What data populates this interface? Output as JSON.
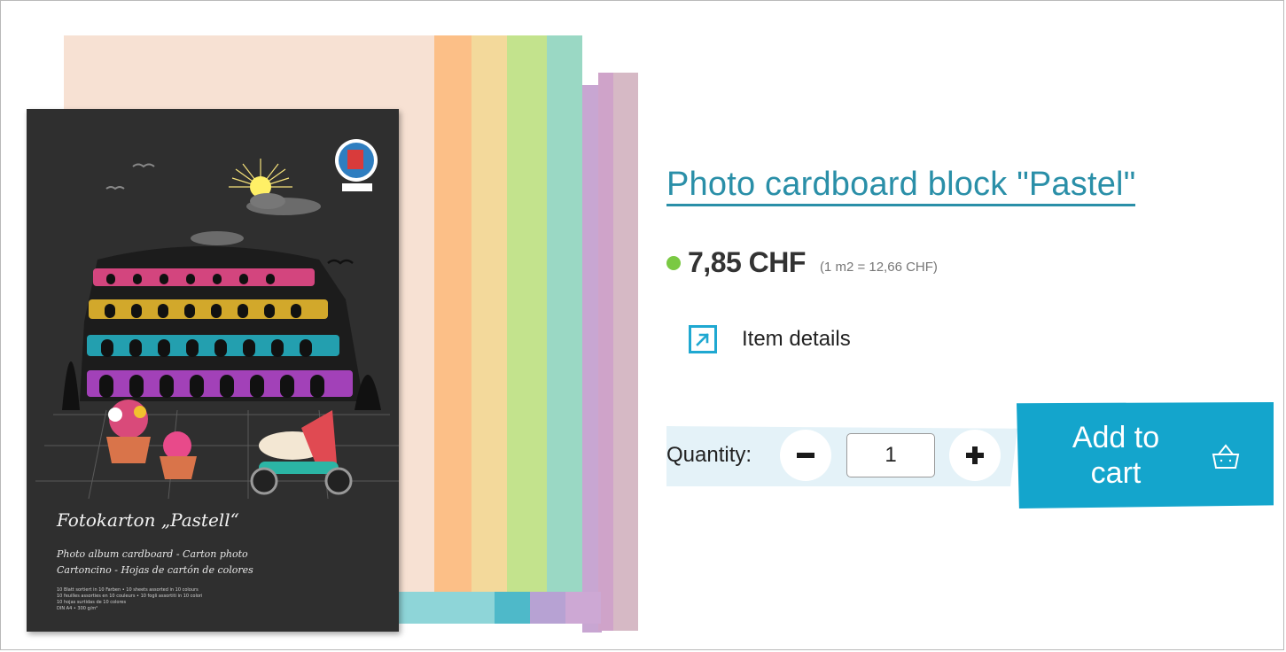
{
  "product": {
    "title": "Photo cardboard block \"Pastel\"",
    "price": "7,85 CHF",
    "unit_price": "(1 m2 = 12,66 CHF)",
    "availability_color": "#7ac943",
    "details_label": "Item details",
    "image": {
      "brand": "URSUS",
      "cover_title": "Fotokarton „Pastell“",
      "cover_subtitle": "Photo album cardboard - Carton photo\nCartoncino - Hojas de cartón de colores",
      "cover_small_print": "10 Blatt sortiert in 10 Farben • 10 sheets assorted in 10 colours\n10 feuilles assorties en 10 couleurs • 10 fogli assortiti in 10 colori\n10 hojas surtidas de 10 colores\nDIN A4 • 300 g/m²",
      "sheet_colors": [
        "#f7e1d3",
        "#fcbf87",
        "#f3d99b",
        "#c3e38d",
        "#9ad8c4",
        "#b7a2d3",
        "#cfa3c9",
        "#d6b9c5",
        "#8ed5d8",
        "#4eb9c9"
      ]
    }
  },
  "purchase": {
    "quantity_label": "Quantity:",
    "quantity_value": "1",
    "decrease_icon": "minus-icon",
    "increase_icon": "plus-icon",
    "cart_label": "Add to cart",
    "cart_icon": "basket-icon"
  },
  "colors": {
    "accent": "#14a5cc",
    "title": "#2a8fa8",
    "quantity_bg": "#e4f2f8"
  }
}
